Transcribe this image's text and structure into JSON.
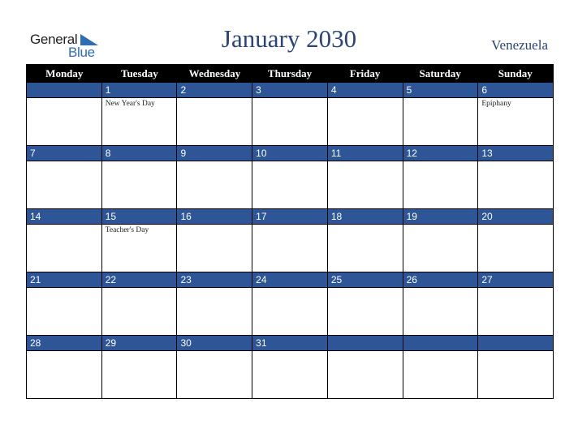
{
  "logo": {
    "word1": "General",
    "word2": "Blue"
  },
  "title": "January 2030",
  "country": "Venezuela",
  "colors": {
    "header_bg": "#000000",
    "daybar_bg": "#2e5596",
    "title": "#2a4475",
    "logo_blue": "#2e6db4"
  },
  "weekdays": [
    "Monday",
    "Tuesday",
    "Wednesday",
    "Thursday",
    "Friday",
    "Saturday",
    "Sunday"
  ],
  "weeks": [
    {
      "days": [
        {
          "num": "",
          "holiday": ""
        },
        {
          "num": "1",
          "holiday": "New Year's Day"
        },
        {
          "num": "2",
          "holiday": ""
        },
        {
          "num": "3",
          "holiday": ""
        },
        {
          "num": "4",
          "holiday": ""
        },
        {
          "num": "5",
          "holiday": ""
        },
        {
          "num": "6",
          "holiday": "Epiphany"
        }
      ]
    },
    {
      "days": [
        {
          "num": "7",
          "holiday": ""
        },
        {
          "num": "8",
          "holiday": ""
        },
        {
          "num": "9",
          "holiday": ""
        },
        {
          "num": "10",
          "holiday": ""
        },
        {
          "num": "11",
          "holiday": ""
        },
        {
          "num": "12",
          "holiday": ""
        },
        {
          "num": "13",
          "holiday": ""
        }
      ]
    },
    {
      "days": [
        {
          "num": "14",
          "holiday": ""
        },
        {
          "num": "15",
          "holiday": "Teacher's Day"
        },
        {
          "num": "16",
          "holiday": ""
        },
        {
          "num": "17",
          "holiday": ""
        },
        {
          "num": "18",
          "holiday": ""
        },
        {
          "num": "19",
          "holiday": ""
        },
        {
          "num": "20",
          "holiday": ""
        }
      ]
    },
    {
      "days": [
        {
          "num": "21",
          "holiday": ""
        },
        {
          "num": "22",
          "holiday": ""
        },
        {
          "num": "23",
          "holiday": ""
        },
        {
          "num": "24",
          "holiday": ""
        },
        {
          "num": "25",
          "holiday": ""
        },
        {
          "num": "26",
          "holiday": ""
        },
        {
          "num": "27",
          "holiday": ""
        }
      ]
    },
    {
      "days": [
        {
          "num": "28",
          "holiday": ""
        },
        {
          "num": "29",
          "holiday": ""
        },
        {
          "num": "30",
          "holiday": ""
        },
        {
          "num": "31",
          "holiday": ""
        },
        {
          "num": "",
          "holiday": ""
        },
        {
          "num": "",
          "holiday": ""
        },
        {
          "num": "",
          "holiday": ""
        }
      ]
    }
  ]
}
